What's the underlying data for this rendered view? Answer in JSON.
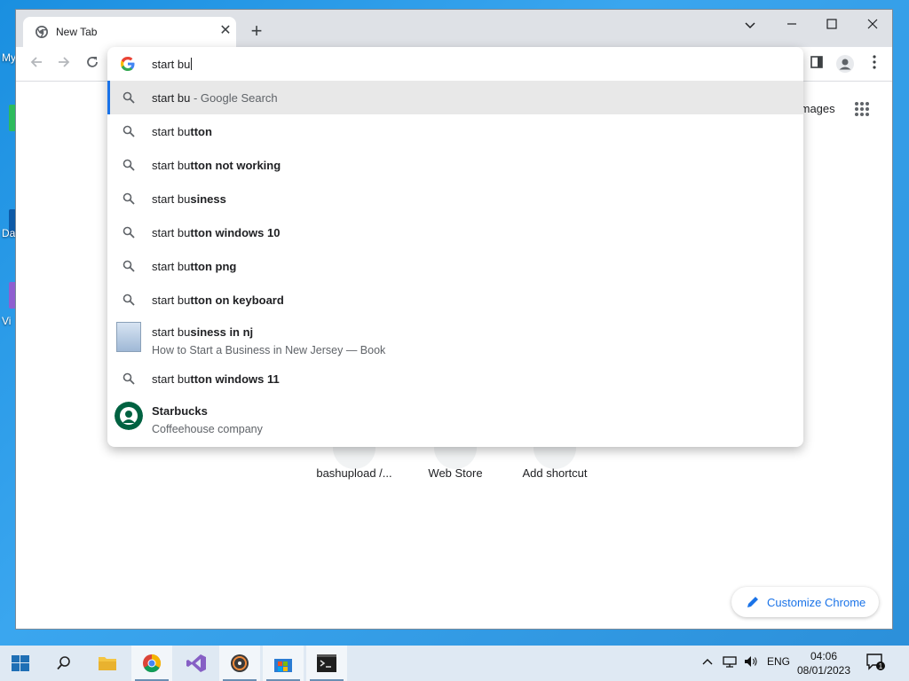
{
  "desktop": {
    "labels": [
      "My",
      "Da",
      "Vi"
    ]
  },
  "browser": {
    "tab_title": "New Tab",
    "omnibox": {
      "value": "start bu",
      "suggestions": [
        {
          "typed": "start bu",
          "completion": "",
          "suffix": " - Google Search",
          "kind": "search",
          "selected": true
        },
        {
          "typed": "start bu",
          "completion": "tton",
          "kind": "search"
        },
        {
          "typed": "start bu",
          "completion": "tton not working",
          "kind": "search"
        },
        {
          "typed": "start bu",
          "completion": "siness",
          "kind": "search"
        },
        {
          "typed": "start bu",
          "completion": "tton windows 10",
          "kind": "search"
        },
        {
          "typed": "start bu",
          "completion": "tton png",
          "kind": "search"
        },
        {
          "typed": "start bu",
          "completion": "tton on keyboard",
          "kind": "search"
        },
        {
          "typed": "start bu",
          "completion": "siness in nj",
          "subtitle": "How to Start a Business in New Jersey — Book",
          "kind": "book"
        },
        {
          "typed": "start bu",
          "completion": "tton windows 11",
          "kind": "search"
        },
        {
          "typed": "",
          "completion": "Starbucks",
          "subtitle": "Coffeehouse company",
          "kind": "entity"
        }
      ]
    },
    "page": {
      "images_link": "Images",
      "shortcuts": [
        "bashupload /...",
        "Web Store",
        "Add shortcut"
      ],
      "customize_label": "Customize Chrome"
    }
  },
  "taskbar": {
    "language": "ENG",
    "time": "04:06",
    "date": "08/01/2023",
    "notification_count": "1"
  },
  "colors": {
    "accent": "#1a73e8",
    "desktop": "#2b8fd9",
    "taskbar": "#dfe9f3"
  }
}
